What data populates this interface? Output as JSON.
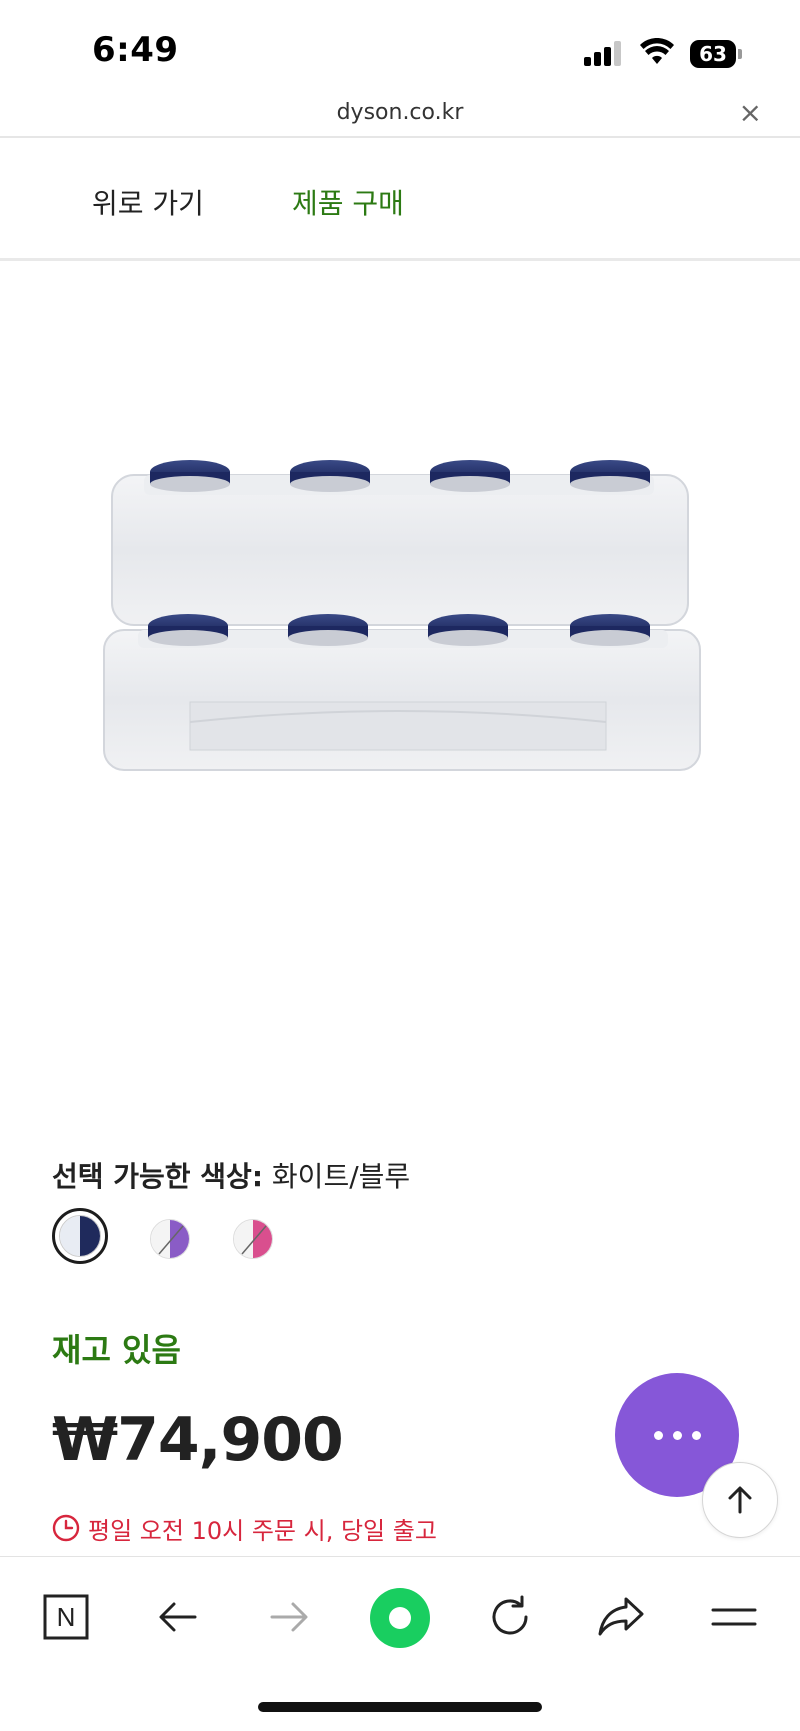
{
  "status_bar": {
    "time": "6:49",
    "battery": "63"
  },
  "url_bar": {
    "domain": "dyson.co.kr",
    "close_symbol": "×"
  },
  "nav_tabs": {
    "back_label": "위로 가기",
    "buy_label": "제품 구매",
    "buy_color": "#2c7a13"
  },
  "product": {
    "color_label": "선택 가능한 색상:",
    "selected_color": "화이트/블루",
    "swatches": [
      {
        "name": "화이트/블루",
        "colors": [
          "#e8ecf3",
          "#1f2a5c"
        ],
        "selected": true
      },
      {
        "name": "purple",
        "colors": [
          "#f4f4f4",
          "#8a5cc6"
        ],
        "selected": false
      },
      {
        "name": "pink",
        "colors": [
          "#f4f4f4",
          "#d94f8e"
        ],
        "selected": false
      }
    ],
    "stock_status": "재고 있음",
    "price": "₩74,900",
    "shipping_notice": "평일 오전 10시 주문 시, 당일 출고"
  },
  "floating": {
    "more_color": "#8657d8",
    "more_icon": "more-dots-icon",
    "top_icon": "arrow-up-icon"
  },
  "toolbar": {
    "icons": [
      "naver-n-icon",
      "back-arrow-icon",
      "forward-arrow-icon",
      "green-dot-icon",
      "reload-icon",
      "share-icon",
      "menu-icon"
    ],
    "home_letter": "N",
    "accent": "#19ce60"
  }
}
